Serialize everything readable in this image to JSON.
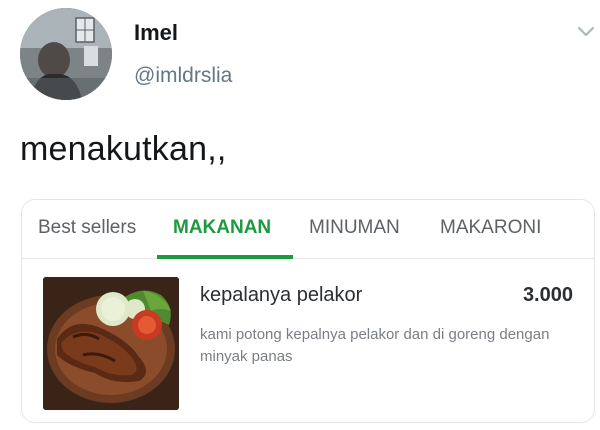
{
  "tweet": {
    "display_name": "Imel",
    "handle": "@imldrslia",
    "text": "menakutkan,,"
  },
  "menu_card": {
    "tabs": [
      {
        "label": "Best sellers",
        "active": false
      },
      {
        "label": "MAKANAN",
        "active": true
      },
      {
        "label": "MINUMAN",
        "active": false
      },
      {
        "label": "MAKARONI",
        "active": false
      }
    ],
    "item": {
      "name": "kepalanya pelakor",
      "price": "3.000",
      "description": "kami potong kepalnya pelakor dan di goreng dengan minyak panas"
    }
  },
  "colors": {
    "accent_green": "#1d9a3f",
    "handle_gray": "#657786",
    "text_dark": "#14171a"
  },
  "icons": {
    "menu_caret": "chevron-down-icon"
  }
}
